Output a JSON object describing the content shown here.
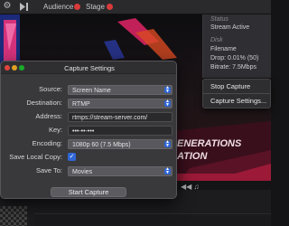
{
  "topbar": {
    "tabs": [
      {
        "label": "Audience",
        "live_color": "#d93a3a"
      },
      {
        "label": "Stage",
        "live_color": "#d93a3a"
      }
    ]
  },
  "video": {
    "overlay_line1": "ENERATIONS",
    "overlay_line2": "ATION"
  },
  "status_panel": {
    "status_label": "Status",
    "status_value": "Stream Active",
    "disk_label": "Disk",
    "filename": "Filename",
    "drop": "Drop: 0.01% (50)",
    "bitrate": "Bitrate: 7.5Mbps"
  },
  "menu": {
    "items": [
      "Stop Capture",
      "Capture Settings..."
    ]
  },
  "dialog": {
    "title": "Capture Settings",
    "source": {
      "label": "Source:",
      "value": "Screen Name"
    },
    "destination": {
      "label": "Destination:",
      "value": "RTMP"
    },
    "address": {
      "label": "Address:",
      "value": "rtmps://stream-server.com/"
    },
    "key": {
      "label": "Key:",
      "value": "•••-••-•••"
    },
    "encoding": {
      "label": "Encoding:",
      "value": "1080p 60 (7.5 Mbps)"
    },
    "save_local": {
      "label": "Save Local Copy:",
      "checked": true
    },
    "save_to": {
      "label": "Save To:",
      "value": "Movies"
    },
    "start_button": "Start Capture"
  },
  "colors": {
    "accent": "#2f66d6",
    "live": "#d93a3a",
    "window_close": "#e0443e",
    "window_min": "#dea123",
    "window_max": "#1aab29"
  }
}
